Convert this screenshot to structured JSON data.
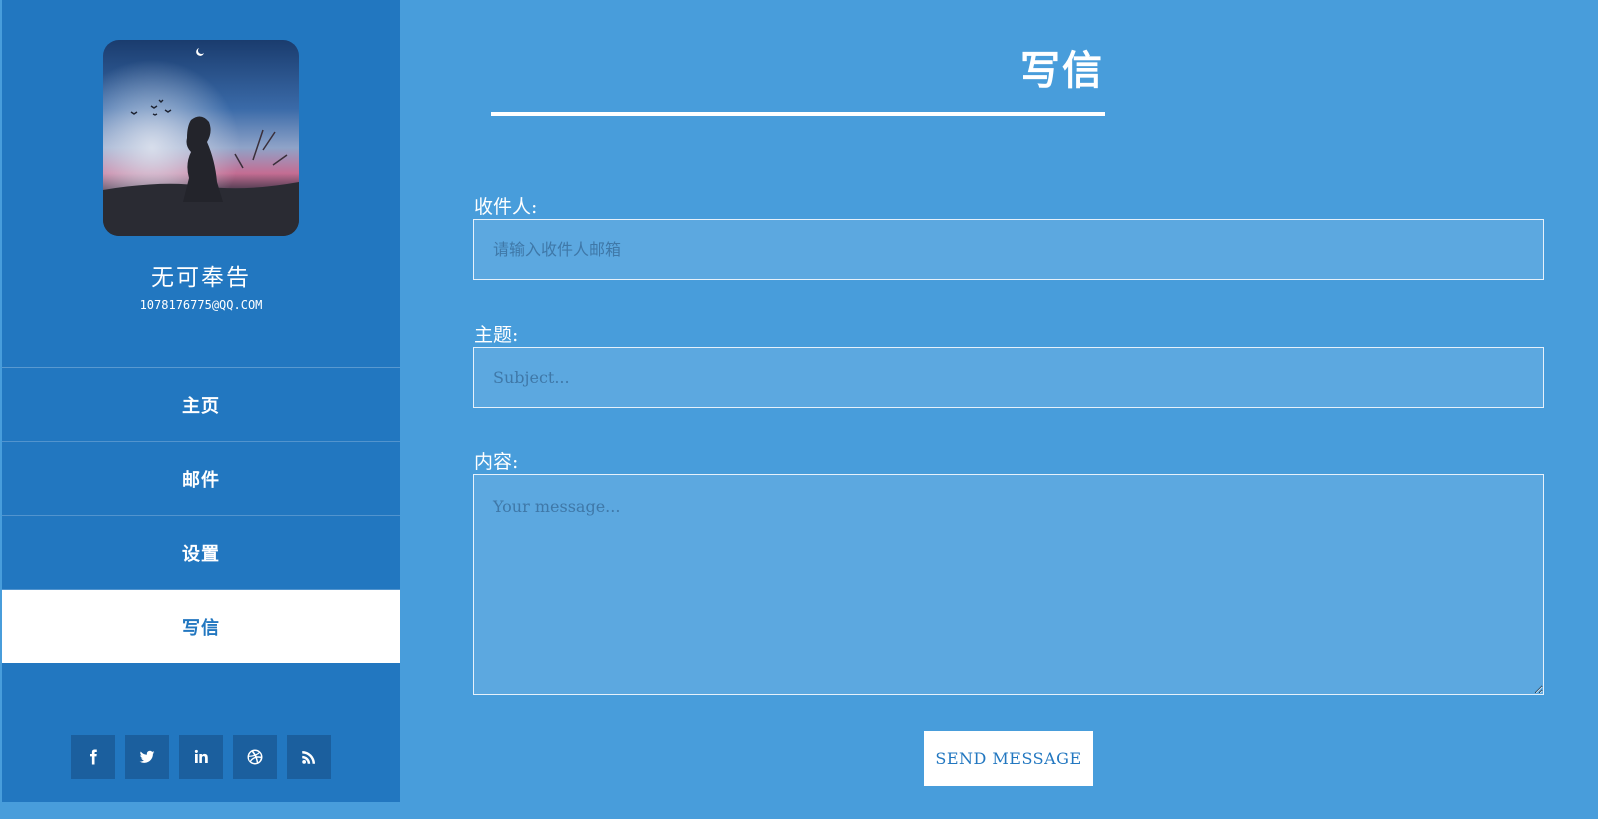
{
  "profile": {
    "name": "无可奉告",
    "email": "1078176775@QQ.COM",
    "avatar_icon": "avatar-silhouette-sunset"
  },
  "nav": {
    "items": [
      {
        "label": "主页",
        "active": false
      },
      {
        "label": "邮件",
        "active": false
      },
      {
        "label": "设置",
        "active": false
      },
      {
        "label": "写信",
        "active": true
      }
    ]
  },
  "social": {
    "icons": [
      "facebook-icon",
      "twitter-icon",
      "linkedin-icon",
      "dribbble-icon",
      "rss-icon"
    ]
  },
  "compose": {
    "title": "写信",
    "recipient_label": "收件人:",
    "recipient_placeholder": "请输入收件人邮箱",
    "recipient_value": "",
    "subject_label": "主题:",
    "subject_placeholder": "Subject...",
    "subject_value": "",
    "content_label": "内容:",
    "content_placeholder": "Your message...",
    "content_value": "",
    "send_label": "SEND MESSAGE"
  },
  "colors": {
    "sidebar": "#2277c0",
    "main": "#489ddb",
    "input_bg": "#5ca8e0",
    "social_bg": "#1b5f9e",
    "active_text": "#2277c0"
  }
}
